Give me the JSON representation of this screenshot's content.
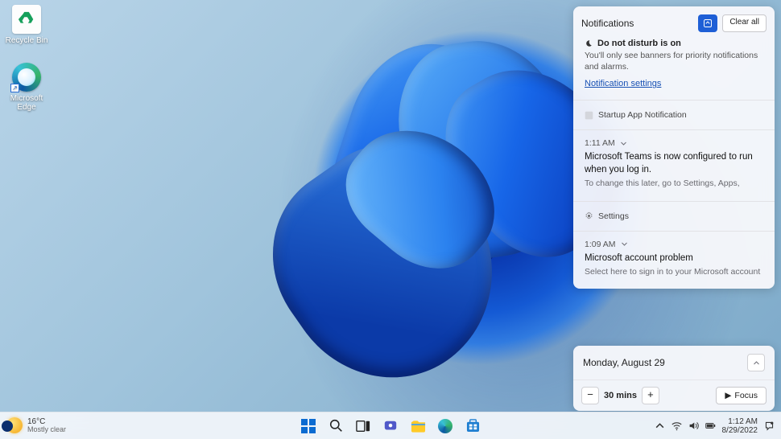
{
  "desktop": {
    "recycle_bin_label": "Recycle Bin",
    "edge_label": "Microsoft Edge"
  },
  "notifications": {
    "header_title": "Notifications",
    "clear_all": "Clear all",
    "dnd_title": "Do not disturb is on",
    "dnd_desc": "You'll only see banners for priority notifications and alarms.",
    "settings_link": "Notification settings",
    "groups": [
      {
        "source": "Startup App Notification",
        "time": "1:11 AM",
        "title": "Microsoft Teams is now configured to run when you log in.",
        "subtitle": "To change this later, go to Settings, Apps,"
      },
      {
        "source": "Settings",
        "time": "1:09 AM",
        "title": "Microsoft account problem",
        "subtitle": "Select here to sign in to your Microsoft account"
      }
    ]
  },
  "calendar": {
    "date": "Monday, August 29",
    "focus_label": "Focus",
    "duration": "30 mins"
  },
  "taskbar": {
    "weather_temp": "16°C",
    "weather_desc": "Mostly clear",
    "time": "1:12 AM",
    "date": "8/29/2022"
  }
}
